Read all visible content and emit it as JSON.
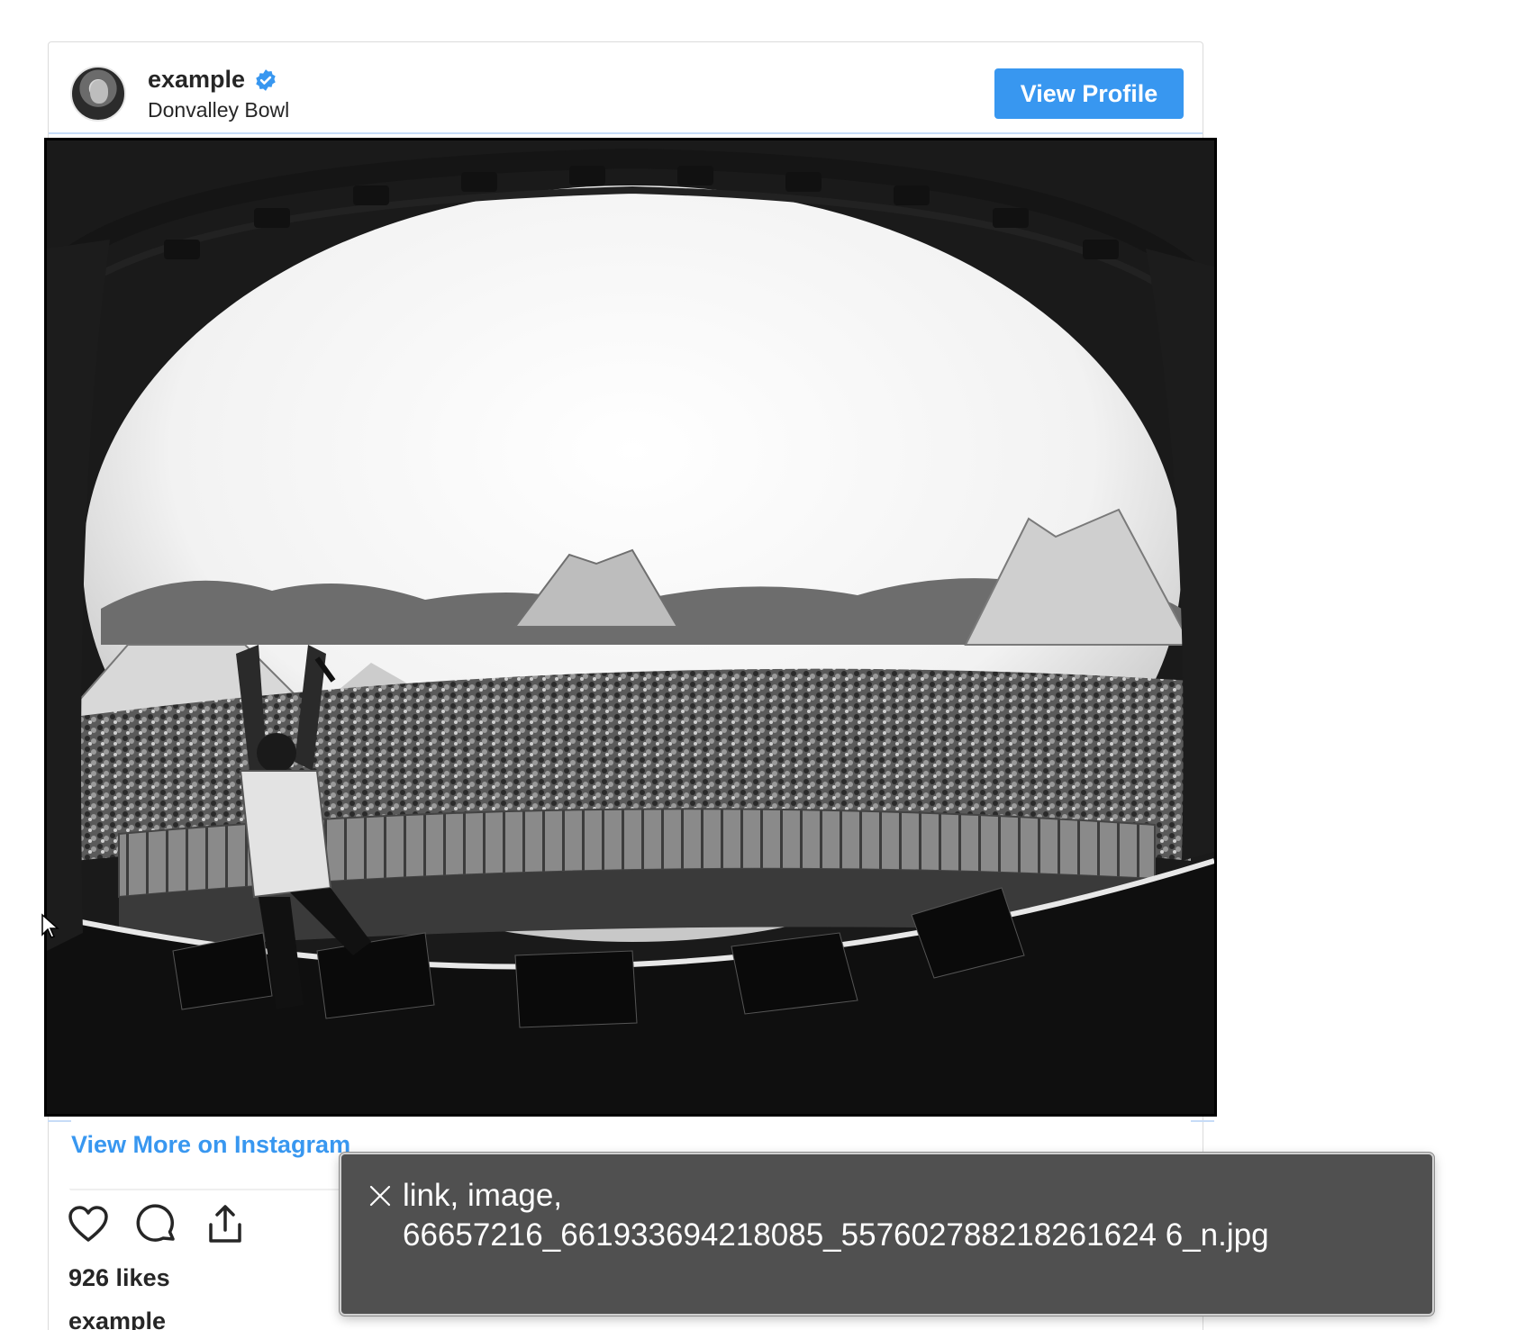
{
  "post": {
    "username": "example",
    "location": "Donvalley Bowl",
    "view_profile_label": "View Profile",
    "verified_icon": "verified-badge-icon",
    "view_more_label": "View More on Instagram",
    "likes_text": "926 likes",
    "caption_username": "example"
  },
  "actions": {
    "like_icon": "heart-icon",
    "comment_icon": "comment-icon",
    "share_icon": "share-icon"
  },
  "accessibility_tooltip": {
    "role_text": "link, image,",
    "filename": "66657216_661933694218085_557602788218261624 6_n.jpg"
  },
  "colors": {
    "accent": "#3897f0",
    "tooltip_bg": "#505050",
    "focus_border": "#000000"
  }
}
